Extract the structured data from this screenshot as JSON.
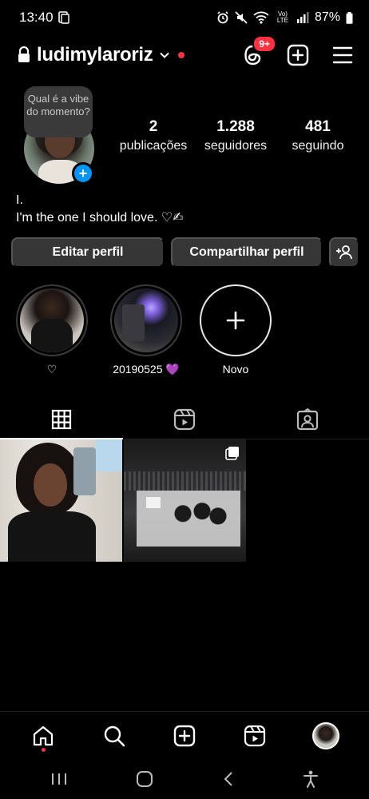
{
  "status_bar": {
    "time": "13:40",
    "network": "Vo) LTE",
    "battery": "87%"
  },
  "header": {
    "username": "ludimylaroriz",
    "notification_badge": "9+"
  },
  "profile": {
    "note_bubble": "Qual é a vibe do momento?",
    "stats": [
      {
        "value": "2",
        "label": "publicações"
      },
      {
        "value": "1.288",
        "label": "seguidores"
      },
      {
        "value": "481",
        "label": "seguindo"
      }
    ],
    "bio_name": "I.",
    "bio_text": "I'm the one I should love. ♡✍"
  },
  "buttons": {
    "edit": "Editar perfil",
    "share": "Compartilhar perfil"
  },
  "highlights": [
    {
      "label": "♡"
    },
    {
      "label": "20190525 💜"
    },
    {
      "label": "Novo"
    }
  ],
  "colors": {
    "accent_blue": "#0095f6",
    "badge_red": "#ff3040",
    "button_bg": "#363636"
  }
}
